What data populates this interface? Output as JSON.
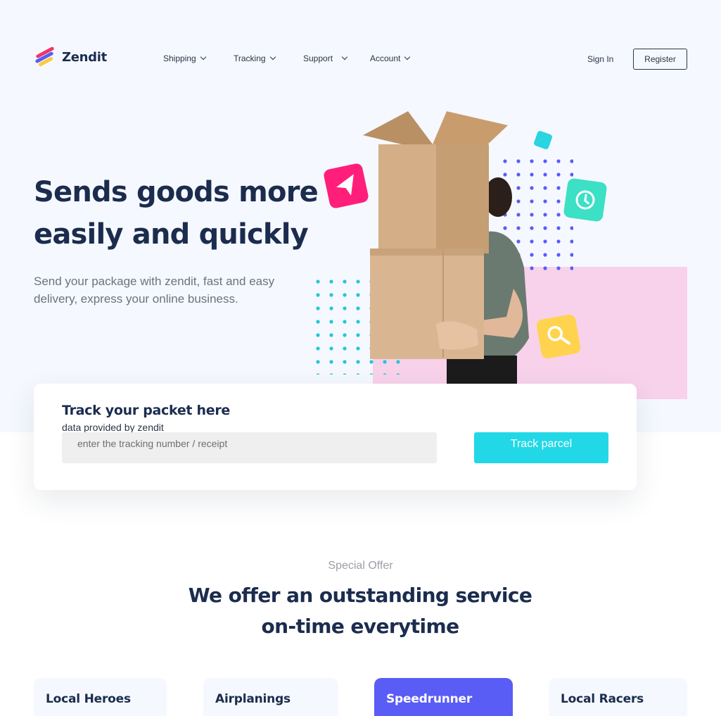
{
  "brand": {
    "name": "Zendit",
    "accent": "#22d8e6",
    "primary": "#5a5cf6",
    "dark": "#1b2c4e"
  },
  "nav": [
    {
      "label": "Shipping"
    },
    {
      "label": "Tracking"
    },
    {
      "label": "Support"
    },
    {
      "label": "Account"
    }
  ],
  "auth": {
    "signin": "Sign In",
    "register": "Register"
  },
  "hero": {
    "headline_line1": "Sends goods more",
    "headline_line2": "easily and quickly",
    "subtext": "Send your package with zendit, fast and easy delivery, express your online business.",
    "icons": [
      "send-icon",
      "clock-icon",
      "search-icon"
    ]
  },
  "tracking": {
    "title": "Track your packet here",
    "subtitle": "data provided by zendit",
    "placeholder": "enter the tracking number / receipt",
    "button": "Track parcel"
  },
  "offer": {
    "eyebrow": "Special Offer",
    "title_line1": "We offer an outstanding service",
    "title_line2": "on-time everytime"
  },
  "services": [
    {
      "label": "Local Heroes",
      "active": false
    },
    {
      "label": "Airplanings",
      "active": false
    },
    {
      "label": "Speedrunner",
      "active": true
    },
    {
      "label": "Local Racers",
      "active": false
    }
  ]
}
